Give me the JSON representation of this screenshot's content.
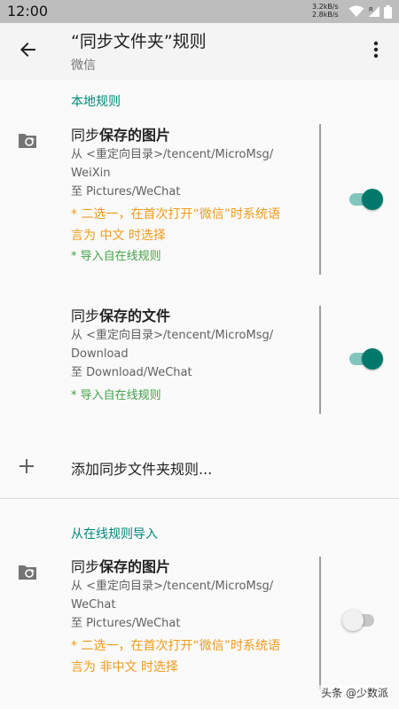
{
  "status_bar": {
    "time": "12:00",
    "net_up": "3.2kB/s",
    "net_down": "2.8kB/s",
    "icons": [
      "wifi-icon",
      "signal-icon",
      "battery-icon"
    ]
  },
  "app_bar": {
    "title": "“同步文件夹”规则",
    "subtitle": "微信"
  },
  "local_section": {
    "header": "本地规则",
    "rules": [
      {
        "title_prefix": "同步",
        "title_bold": "保存的图片",
        "source_line1": "从 <重定向目录>/tencent/MicroMsg/",
        "source_line2": "WeiXin",
        "target": "至 Pictures/WeChat",
        "note_orange_line1": "* 二选一，在首次打开“微信”时系统语",
        "note_orange_line2": "言为 中文 时选择",
        "note_green": "* 导入自在线规则",
        "enabled": true
      },
      {
        "title_prefix": "同步",
        "title_bold": "保存的文件",
        "source_line1": "从 <重定向目录>/tencent/MicroMsg/",
        "source_line2": "Download",
        "target": "至 Download/WeChat",
        "note_green": "* 导入自在线规则",
        "enabled": true
      }
    ],
    "add_label": "添加同步文件夹规则..."
  },
  "online_section": {
    "header": "从在线规则导入",
    "rules": [
      {
        "title_prefix": "同步",
        "title_bold": "保存的图片",
        "source_line1": "从 <重定向目录>/tencent/MicroMsg/",
        "source_line2": "WeChat",
        "target": "至 Pictures/WeChat",
        "note_orange_line1": "* 二选一，在首次打开“微信”时系统语",
        "note_orange_line2": "言为 非中文 时选择",
        "enabled": false
      }
    ]
  },
  "watermark": "头条 @少数派",
  "colors": {
    "accent": "#00897b",
    "note_orange": "#ef9a1a",
    "note_green": "#43a047"
  }
}
